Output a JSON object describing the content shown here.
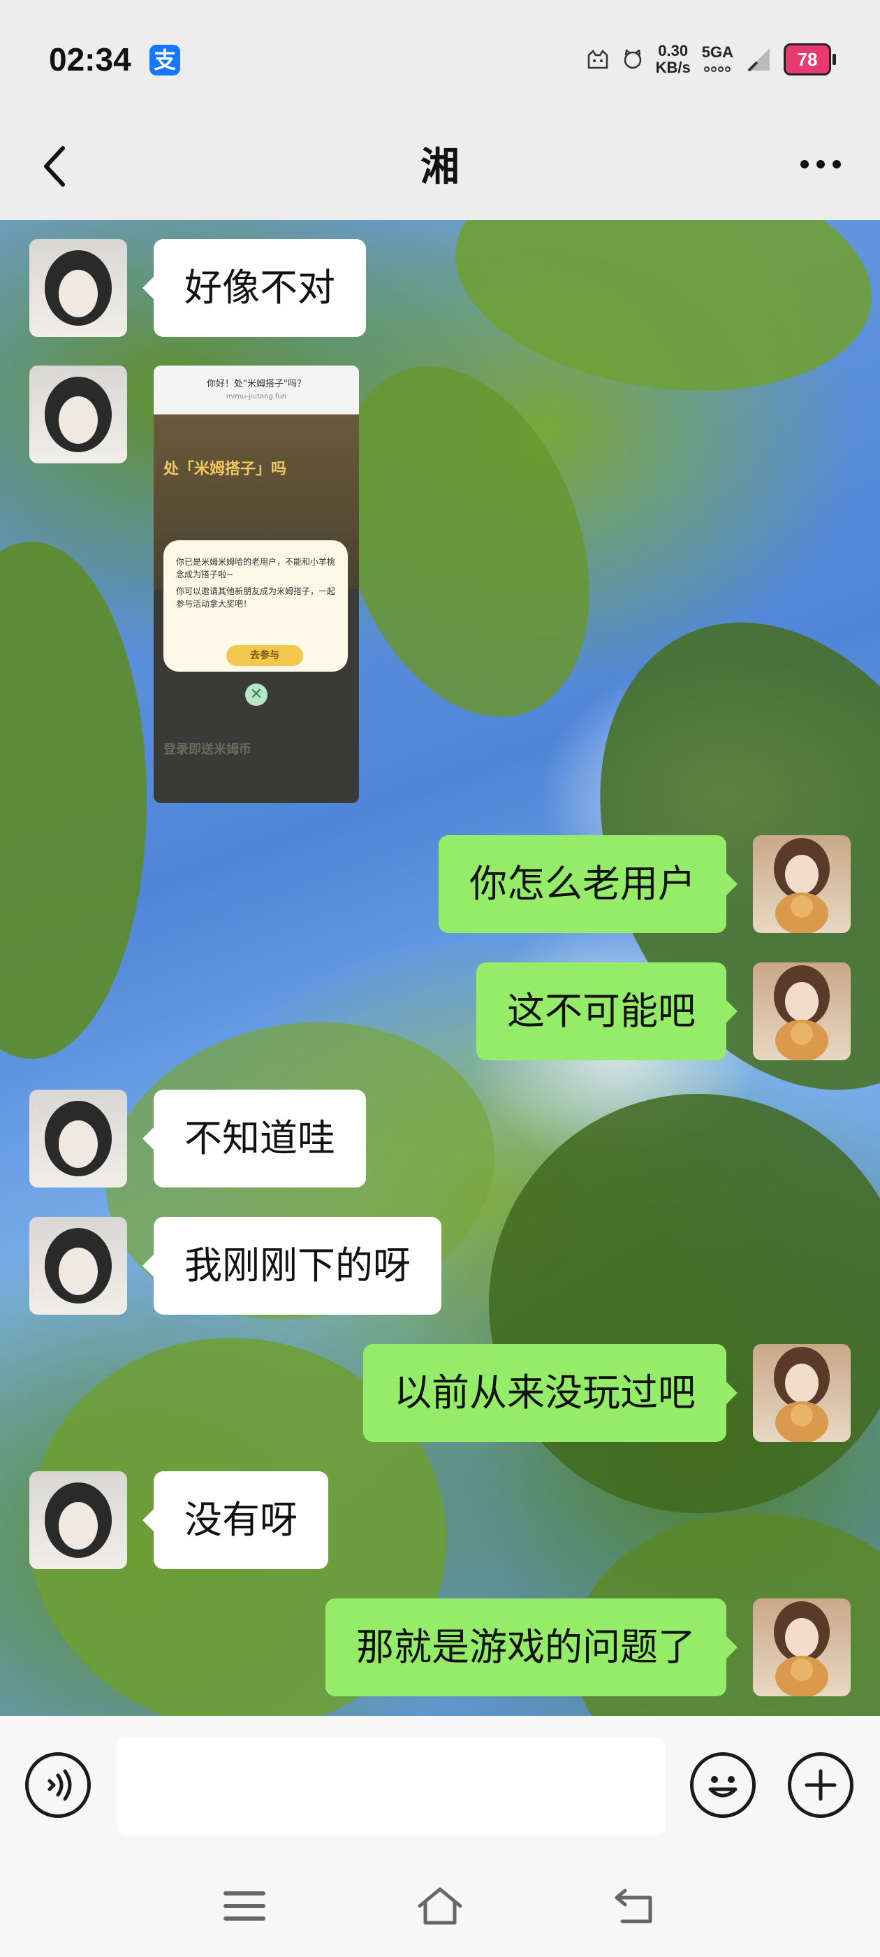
{
  "status_bar": {
    "time": "02:34",
    "alipay_icon_text": "支",
    "net_speed_value": "0.30",
    "net_speed_unit": "KB/s",
    "signal": "5GA",
    "battery": "78"
  },
  "header": {
    "title": "湘"
  },
  "messages": [
    {
      "side": "left",
      "type": "text",
      "text": "好像不对"
    },
    {
      "side": "left",
      "type": "image"
    },
    {
      "side": "right",
      "type": "text",
      "text": "你怎么老用户"
    },
    {
      "side": "right",
      "type": "text",
      "text": "这不可能吧"
    },
    {
      "side": "left",
      "type": "text",
      "text": "不知道哇"
    },
    {
      "side": "left",
      "type": "text",
      "text": "我刚刚下的呀"
    },
    {
      "side": "right",
      "type": "text",
      "text": "以前从来没玩过吧"
    },
    {
      "side": "left",
      "type": "text",
      "text": "没有呀"
    },
    {
      "side": "right",
      "type": "text",
      "text": "那就是游戏的问题了"
    }
  ],
  "screenshot_message": {
    "top_title": "你好！处\"米姆搭子\"吗？",
    "top_url": "mimu-jiutang.fun",
    "brand": "处「米姆搭子」吗",
    "dialog_line1": "你已是米姆米姆哈的老用户，不能和小羊桃念成为搭子啦~",
    "dialog_line2": "你可以邀请其他新朋友成为米姆搭子，一起参与活动拿大奖吧！",
    "join_button": "去参与",
    "bottom_text": "登录即送米姆币"
  },
  "icons": {
    "back": "back-arrow-icon",
    "more": "more-options-icon",
    "voice": "voice-input-icon",
    "emoji": "emoji-icon",
    "plus": "plus-icon",
    "nav_menu": "menu-icon",
    "nav_home": "home-icon",
    "nav_back": "back-icon"
  },
  "colors": {
    "outgoing_bubble": "#95ec69",
    "incoming_bubble": "#ffffff",
    "bar_background": "#ededed"
  }
}
